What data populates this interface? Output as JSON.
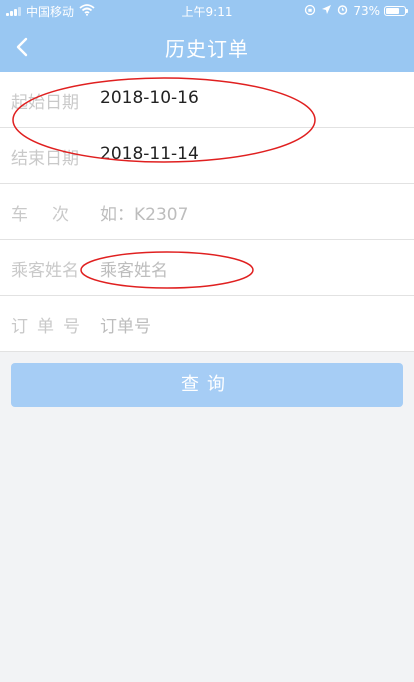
{
  "status_bar": {
    "carrier": "中国移动",
    "time": "上午9:11",
    "battery": "73%",
    "battery_level": 0.73,
    "icons": [
      "signal-icon",
      "wifi-icon",
      "orientation-lock-icon",
      "location-icon",
      "alarm-icon",
      "battery-icon"
    ]
  },
  "header": {
    "title": "历史订单",
    "back_icon": "chevron-left-icon",
    "background": "#99c7f2"
  },
  "form": {
    "start_date": {
      "label": "起始日期",
      "value": "2018-10-16"
    },
    "end_date": {
      "label": "结束日期",
      "value": "2018-11-14"
    },
    "train_no": {
      "label": "车次",
      "placeholder": "如：K2307"
    },
    "passenger_name": {
      "label": "乘客姓名",
      "placeholder": "乘客姓名"
    },
    "order_no": {
      "label": "订单号",
      "placeholder": "订单号"
    }
  },
  "query_button": {
    "label": "查询",
    "color": "#a6cdf5"
  },
  "annotations": {
    "color": "#e02020"
  }
}
